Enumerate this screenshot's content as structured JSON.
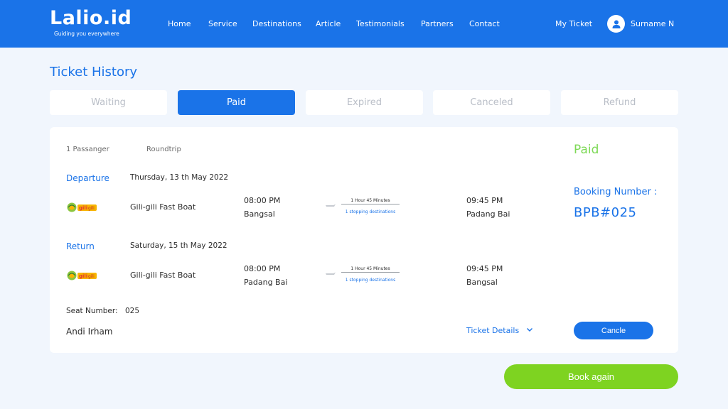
{
  "brand": {
    "name": "Lalio.id",
    "tagline": "Guiding you everywhere"
  },
  "nav": {
    "items": [
      "Home",
      "Service",
      "Destinations",
      "Article",
      "Testimonials",
      "Partners",
      "Contact"
    ],
    "my_ticket": "My Ticket",
    "user_name": "Surname N"
  },
  "page": {
    "title": "Ticket History"
  },
  "tabs": [
    {
      "label": "Waiting",
      "active": false
    },
    {
      "label": "Paid",
      "active": true
    },
    {
      "label": "Expired",
      "active": false
    },
    {
      "label": "Canceled",
      "active": false
    },
    {
      "label": "Refund",
      "active": false
    }
  ],
  "ticket": {
    "passengers": "1 Passanger",
    "trip_type": "Roundtrip",
    "status": "Paid",
    "booking_label": "Booking Number :",
    "booking_number": "BPB#025",
    "departure": {
      "label": "Departure",
      "date": "Thursday, 13 th May 2022",
      "boat": "Gili-gili Fast Boat",
      "dep_time": "08:00 PM",
      "dep_place": "Bangsal",
      "duration": "1 Hour 45 Minutes",
      "stops": "1 stopping destinations",
      "arr_time": "09:45 PM",
      "arr_place": "Padang Bai"
    },
    "return": {
      "label": "Return",
      "date": "Saturday, 15 th May 2022",
      "boat": "Gili-gili Fast Boat",
      "dep_time": "08:00 PM",
      "dep_place": "Padang Bai",
      "duration": "1 Hour 45 Minutes",
      "stops": "1 stopping destinations",
      "arr_time": "09:45 PM",
      "arr_place": "Bangsal"
    },
    "seat_label": "Seat Number:",
    "seat_number": "025",
    "passenger_name": "Andi Irham",
    "details_label": "Ticket Details",
    "cancel_label": "Cancle"
  },
  "book_again_label": "Book again",
  "colors": {
    "primary": "#1a73e8",
    "success": "#7ed957",
    "button_green": "#7ed321",
    "background": "#f1f6fd"
  }
}
